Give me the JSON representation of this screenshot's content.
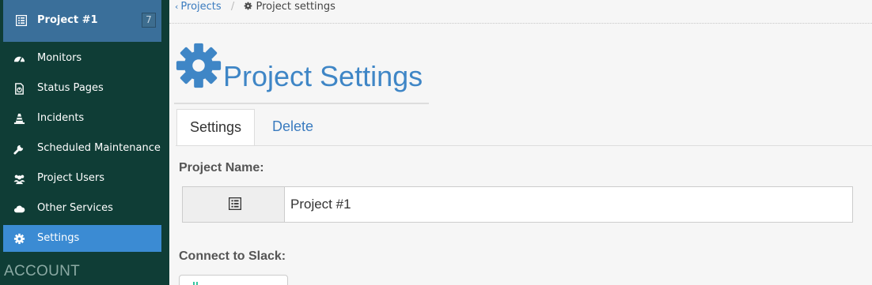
{
  "sidebar": {
    "project": {
      "name": "Project #1",
      "count": "7"
    },
    "items": [
      {
        "label": "Monitors",
        "icon": "dashboard-icon"
      },
      {
        "label": "Status Pages",
        "icon": "file-chart-icon"
      },
      {
        "label": "Incidents",
        "icon": "cone-icon"
      },
      {
        "label": "Scheduled Maintenance",
        "icon": "wrench-icon"
      },
      {
        "label": "Project Users",
        "icon": "users-icon"
      },
      {
        "label": "Other Services",
        "icon": "cloud-icon"
      },
      {
        "label": "Settings",
        "icon": "gear-icon",
        "active": true
      }
    ],
    "section_label": "ACCOUNT"
  },
  "breadcrumb": {
    "back_label": "Projects",
    "current_label": "Project settings"
  },
  "page": {
    "title": "Project Settings"
  },
  "tabs": [
    {
      "label": "Settings",
      "active": true
    },
    {
      "label": "Delete"
    }
  ],
  "form": {
    "project_name_label": "Project Name:",
    "project_name_value": "Project #1",
    "slack_label": "Connect to Slack:"
  },
  "colors": {
    "sidebar_bg": "#0f3d36",
    "project_header_bg": "#3a6f9a",
    "active_item_bg": "#3b8bd3",
    "accent": "#3f86c6"
  }
}
